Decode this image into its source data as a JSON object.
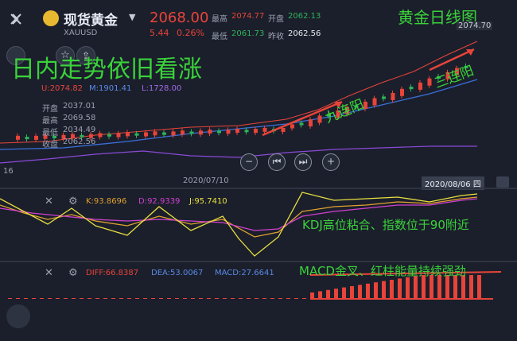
{
  "header": {
    "back_icon": "chevron-left-icon",
    "product_name": "现货黄金",
    "symbol": "XAUUSD",
    "price": "2068.00",
    "change": "5.44",
    "change_pct": "0.26%",
    "high_label": "最高",
    "high_value": "2074.77",
    "low_label": "最低",
    "low_value": "2061.73",
    "open_label": "开盘",
    "open_value": "2062.13",
    "prev_close_label": "昨收",
    "prev_close_value": "2062.56"
  },
  "annotations": {
    "chart_title": "黄金日线图",
    "main_headline": "日内走势依旧看涨",
    "nine_yang": "九连阳",
    "three_yang": "三连阳",
    "kdj_note": "KDJ高位粘合、指数位于90附近",
    "macd_note": "MACD金叉、红柱能量持续强劲"
  },
  "main_chart": {
    "ma_upper": "U:2074.82",
    "ma_mid": "M:1901.41",
    "ma_lower": "L:1728.00",
    "price_top_label": "2074.70",
    "y_axis_left_label": "16",
    "info_box": {
      "open_label": "开盘",
      "open_value": "2037.01",
      "high_label": "最高",
      "high_value": "2069.58",
      "low_label": "最低",
      "low_value": "2034.49",
      "close_label": "收盘",
      "close_value": "2062.56"
    },
    "date_labels": [
      "2020/07/10",
      "2020/08/06 四"
    ],
    "controls": [
      "minus-icon",
      "skip-back-icon",
      "skip-forward-icon",
      "plus-icon"
    ]
  },
  "kdj": {
    "k": "K:93.8696",
    "d": "D:92.9339",
    "j": "J:95.7410"
  },
  "macd": {
    "diff": "DIFF:66.8387",
    "dea": "DEA:53.0067",
    "macd": "MACD:27.6641"
  },
  "colors": {
    "up": "#e8443a",
    "down": "#2fb35a",
    "k_line": "#e0a030",
    "d_line": "#d040d0",
    "j_line": "#e8e040",
    "mid_line": "#3a6fd8",
    "lower_line": "#8a4ad8",
    "annotation": "#3ad33a"
  }
}
